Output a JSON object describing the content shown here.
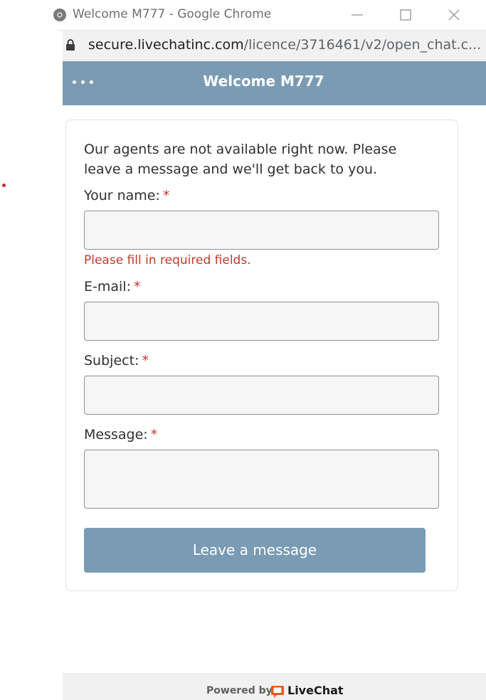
{
  "window": {
    "title": "Welcome M777 - Google Chrome",
    "url_domain": "secure.livechatinc.com",
    "url_path": "/licence/3716461/v2/open_chat.c..."
  },
  "chat": {
    "header_title": "Welcome M777",
    "intro": "Our agents are not available right now. Please leave a message and we'll get back to you.",
    "required_marker": "*",
    "fields": {
      "name_label": "Your name:",
      "name_error": "Please fill in required fields.",
      "email_label": "E-mail:",
      "subject_label": "Subject:",
      "message_label": "Message:"
    },
    "submit_label": "Leave a message"
  },
  "footer": {
    "powered_by": "Powered by",
    "brand": "LiveChat"
  },
  "colors": {
    "header": "#7a9bb3",
    "error": "#c0392b",
    "brand_accent": "#e65b1e"
  },
  "icons": [
    "chrome-icon",
    "minimize-icon",
    "maximize-icon",
    "close-icon",
    "lock-icon",
    "menu-dots-icon",
    "livechat-logo-icon"
  ]
}
